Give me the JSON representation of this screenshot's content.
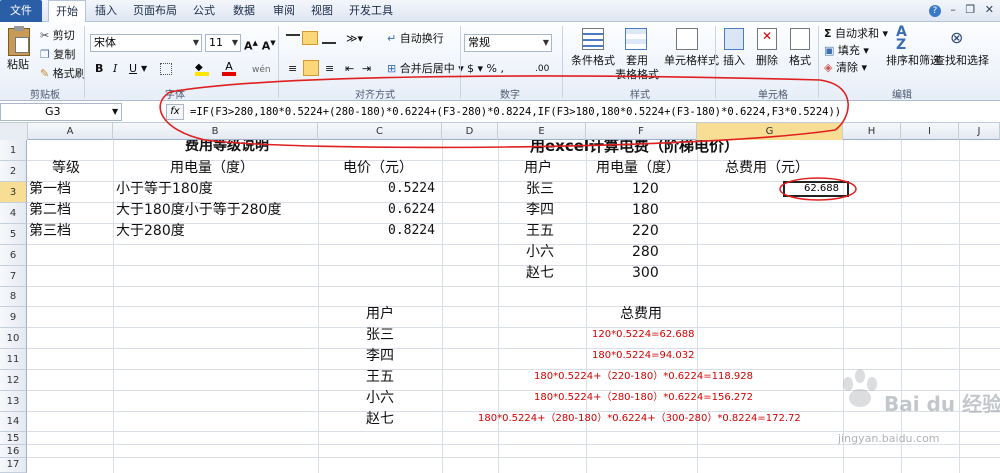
{
  "menu": {
    "tabs": [
      "文件",
      "开始",
      "插入",
      "页面布局",
      "公式",
      "数据",
      "审阅",
      "视图",
      "开发工具"
    ]
  },
  "ribbon": {
    "paste": "粘贴",
    "cut": "剪切",
    "copy": "复制",
    "format_painter": "格式刷",
    "clipboard_group": "剪贴板",
    "font_name": "宋体",
    "font_size": "11",
    "font_group": "字体",
    "wrap_text": "自动换行",
    "merge_center": "合并后居中",
    "align_group": "对齐方式",
    "number_format": "常规",
    "number_group": "数字",
    "cond_format": "条件格式",
    "table_format1": "套用",
    "table_format2": "表格格式",
    "cell_style": "单元格样式",
    "style_group": "样式",
    "insert": "插入",
    "delete": "删除",
    "format": "格式",
    "cells_group": "单元格",
    "autosum": "自动求和",
    "fill": "填充",
    "clear": "清除",
    "sort_filter": "排序和筛选",
    "find_select": "查找和选择",
    "edit_group": "编辑"
  },
  "formula_bar": {
    "name": "G3",
    "fx": "fx",
    "formula": "=IF(F3>280,180*0.5224+(280-180)*0.6224+(F3-280)*0.8224,IF(F3>180,180*0.5224+(F3-180)*0.6224,F3*0.5224))"
  },
  "columns": [
    "A",
    "B",
    "C",
    "D",
    "E",
    "F",
    "G",
    "H",
    "I",
    "J"
  ],
  "rows": [
    "1",
    "2",
    "3",
    "4",
    "5",
    "6",
    "7",
    "8",
    "9",
    "10",
    "11",
    "12",
    "13",
    "14",
    "15",
    "16",
    "17"
  ],
  "sheet": {
    "title_left": "费用等级说明",
    "title_right": "用excel计算电费（阶梯电价）",
    "hdr_level": "等级",
    "hdr_usage": "用电量（度）",
    "hdr_price": "电价（元）",
    "tiers": [
      {
        "level": "第一档",
        "range": "小于等于180度",
        "price": "0.5224"
      },
      {
        "level": "第二档",
        "range": "大于180度小于等于280度",
        "price": "0.6224"
      },
      {
        "level": "第三档",
        "range": "大于280度",
        "price": "0.8224"
      }
    ],
    "hdr_user": "用户",
    "hdr_usage2": "用电量（度）",
    "hdr_total": "总费用（元）",
    "users": [
      {
        "name": "张三",
        "usage": "120"
      },
      {
        "name": "李四",
        "usage": "180"
      },
      {
        "name": "王五",
        "usage": "220"
      },
      {
        "name": "小六",
        "usage": "280"
      },
      {
        "name": "赵七",
        "usage": "300"
      }
    ],
    "g3_value": "62.688",
    "hdr_user2": "用户",
    "hdr_total2": "总费用",
    "calc": [
      {
        "name": "张三",
        "expr": "120*0.5224=62.688"
      },
      {
        "name": "李四",
        "expr": "180*0.5224=94.032"
      },
      {
        "name": "王五",
        "expr": "180*0.5224+（220-180）*0.6224=118.928"
      },
      {
        "name": "小六",
        "expr": "180*0.5224+（280-180）*0.6224=156.272"
      },
      {
        "name": "赵七",
        "expr": "180*0.5224+（280-180）*0.6224+（300-280）*0.8224=172.72"
      }
    ]
  },
  "watermark": {
    "brand": "Bai du 经验",
    "url": "jingyan.baidu.com"
  }
}
